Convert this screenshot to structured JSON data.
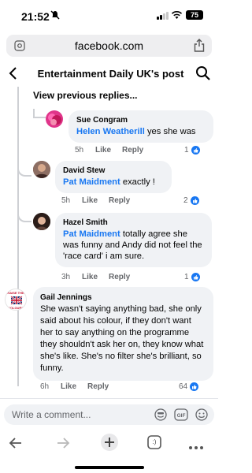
{
  "status_bar": {
    "time": "21:52",
    "battery": "75"
  },
  "browser": {
    "url": "facebook.com"
  },
  "header": {
    "title": "Entertainment Daily UK's post"
  },
  "thread": {
    "view_previous": "View previous replies..."
  },
  "comments": [
    {
      "author": "Sue Congram",
      "mention": "Helen Weatherill",
      "text": " yes she was",
      "time": "5h",
      "like": "Like",
      "reply": "Reply",
      "reactions": "1",
      "avatar_color": "#e0358a"
    },
    {
      "author": "David Stew",
      "mention": "Pat Maidment",
      "text": " exactly !",
      "time": "5h",
      "like": "Like",
      "reply": "Reply",
      "reactions": "2",
      "avatar_color": "#6b4a3a"
    },
    {
      "author": "Hazel Smith",
      "mention": "Pat Maidment",
      "text": " totally agree  she was funny and Andy did not feel the 'race card' i am sure.",
      "time": "3h",
      "like": "Like",
      "reply": "Reply",
      "reactions": "1",
      "avatar_color": "#3b2a24"
    },
    {
      "author": "Gail Jennings",
      "mention": "",
      "text": "She wasn't saying anything bad, she only said about his colour, if they don't want her to say anything on the programme they shouldn't ask her on, they know what she's like. She's no filter she's brilliant, so funny.",
      "time": "6h",
      "like": "Like",
      "reply": "Reply",
      "reactions": "64",
      "avatar_label_top": "RAISE THE",
      "avatar_label_bottom": "COLOURS"
    }
  ],
  "composer": {
    "placeholder": "Write a comment..."
  },
  "colors": {
    "accent": "#1877f2",
    "bubble": "#f0f2f5",
    "meta": "#65676b"
  },
  "icons": [
    "back-icon",
    "search-icon",
    "share-icon",
    "sticker-icon",
    "gif-icon",
    "emoji-icon",
    "back-arrow-icon",
    "forward-arrow-icon",
    "new-tab-icon",
    "tabs-icon",
    "more-icon"
  ],
  "bottom_nav": {
    "tabs_count": ":)"
  }
}
